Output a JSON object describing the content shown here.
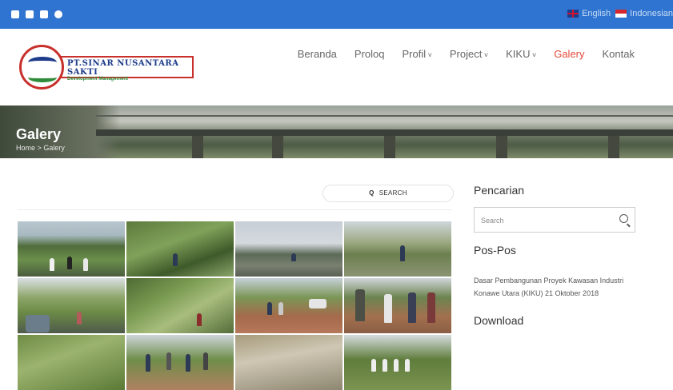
{
  "topbar": {
    "social_icons": [
      "facebook-icon",
      "instagram-icon",
      "twitter-icon",
      "dribbble-icon"
    ],
    "lang_english": "English",
    "lang_indonesian": "Indonesian"
  },
  "logo": {
    "name": "PT.SINAR NUSANTARA SAKTI",
    "tagline": "Development Management"
  },
  "nav": {
    "items": [
      {
        "label": "Beranda"
      },
      {
        "label": "Proloq"
      },
      {
        "label": "Profil"
      },
      {
        "label": "Project"
      },
      {
        "label": "KIKU"
      },
      {
        "label": "Galery"
      },
      {
        "label": "Kontak"
      }
    ],
    "active": "Galery",
    "accent_color": "#e5493a"
  },
  "hero": {
    "title": "Galery",
    "breadcrumb_home": "Home",
    "breadcrumb_sep": ">",
    "breadcrumb_current": "Galery"
  },
  "gallery": {
    "search_label": "SEARCH"
  },
  "sidebar": {
    "search_heading": "Pencarian",
    "search_placeholder": "Search",
    "posts_heading": "Pos-Pos",
    "post_title": "Dasar Pembangunan Proyek Kawasan Industri Konawe Utara (KIKU) 21 Oktober 2018",
    "download_heading": "Download"
  },
  "colors": {
    "topbar": "#2f74d0",
    "brand_red": "#c8302c",
    "brand_blue": "#1d3c8a",
    "brand_green": "#2e8b3a"
  }
}
